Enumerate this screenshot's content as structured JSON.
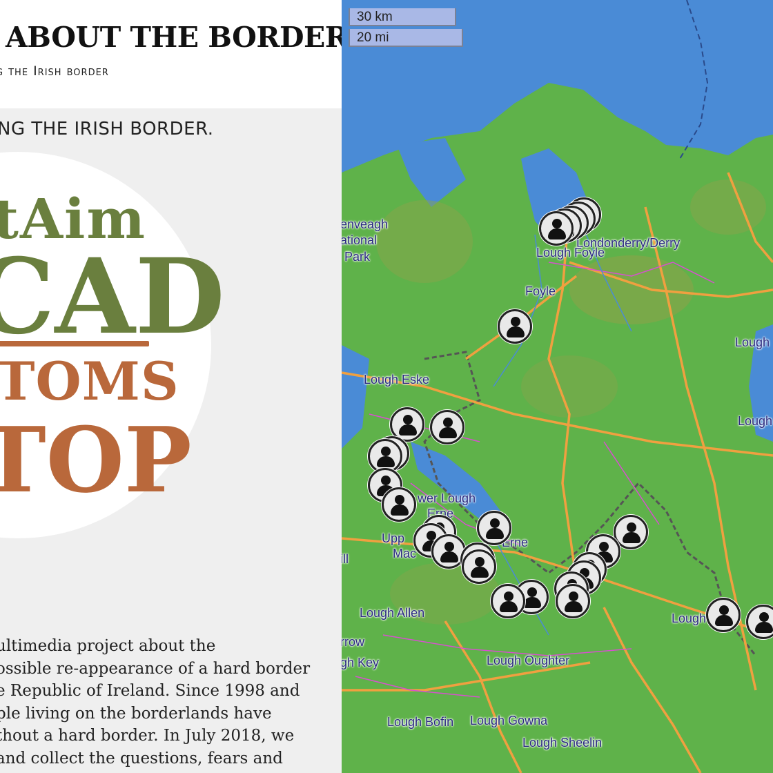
{
  "header": {
    "title": "ABOUT THE BORDER",
    "tagline": "g the Irish border"
  },
  "section": {
    "heading": "NG THE IRISH BORDER."
  },
  "logo": {
    "line1": "tAim",
    "line2": "CAD",
    "line3": "TOMS",
    "line4": "TOP"
  },
  "intro": {
    "lines": [
      "ultimedia project about the",
      "ossible re-appearance of a hard border",
      "e Republic of Ireland. Since 1998 and",
      "ple living on the borderlands have",
      "thout a hard border. In July 2018, we",
      " and collect the questions, fears and"
    ]
  },
  "map": {
    "scale": {
      "km": "30 km",
      "mi": "20 mi"
    },
    "places": [
      "enveagh",
      "ational",
      "Park",
      "Londonderry/Derry",
      "Lough Foyle",
      "Foyle",
      "Lough",
      "Lough Eske",
      "Lough",
      "wer Lough",
      "Erne",
      "Upp",
      "Mac",
      "Erne",
      "Lough Allen",
      "rrow",
      "gh Key",
      "Lough Oughter",
      "Lough Bofin",
      "Lough Gowna",
      "Lough Sheelin",
      "Lough",
      "ill"
    ],
    "colors": {
      "sea": "#4a8bd6",
      "land": "#5fb24a",
      "road": "#f0a040",
      "minor_road": "#d84fd0",
      "border": "#555555",
      "scale_box": "#a9b8e6"
    }
  }
}
